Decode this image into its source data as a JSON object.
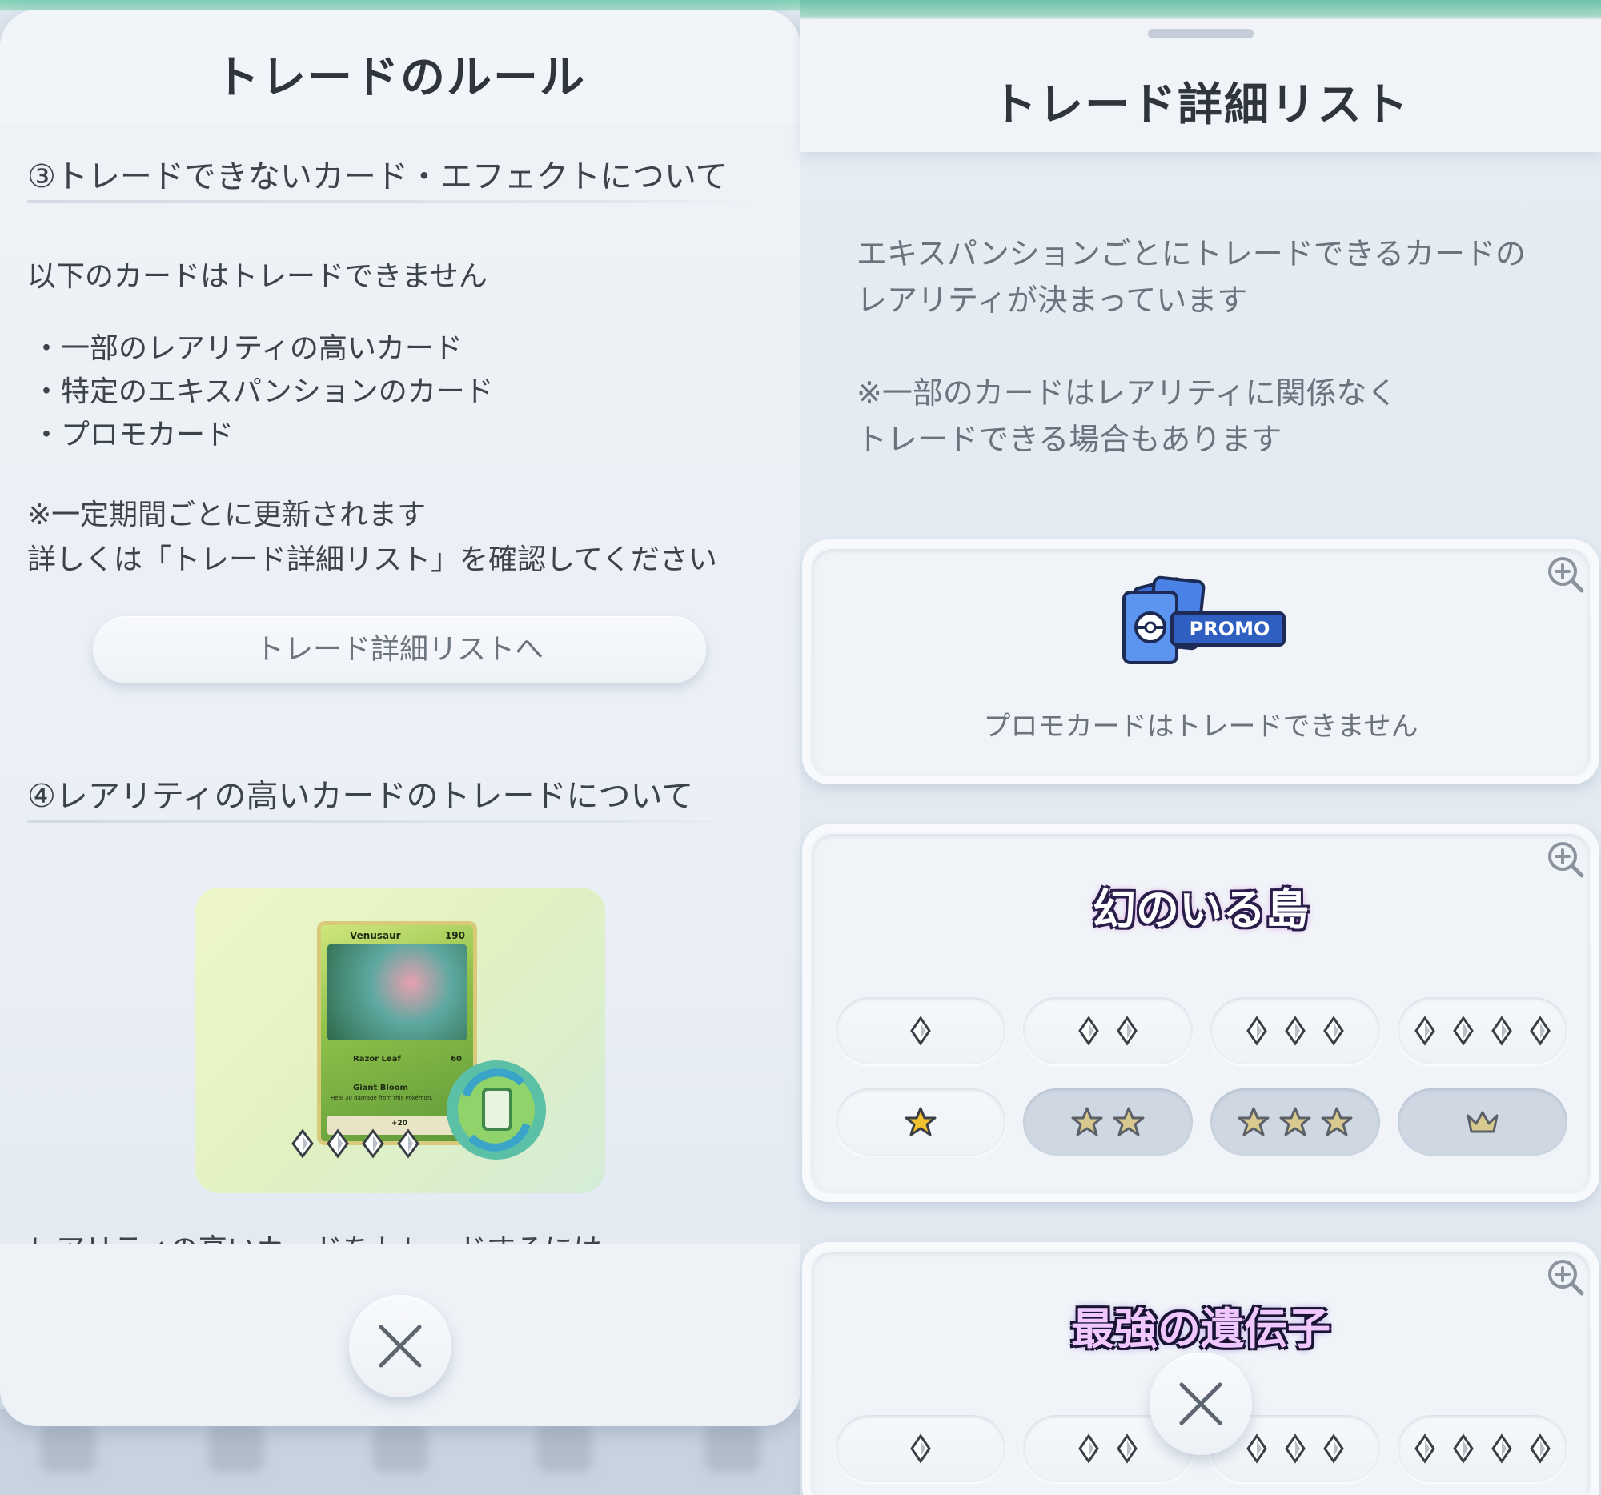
{
  "left": {
    "title": "トレードのルール",
    "section3_title": "③トレードできないカード・エフェクトについて",
    "intro": "以下のカードはトレードできません",
    "bullets": [
      "・一部のレアリティの高いカード",
      "・特定のエキスパンションのカード",
      "・プロモカード"
    ],
    "note_line1": "※一定期間ごとに更新されます",
    "note_line2": "詳しくは「トレード詳細リスト」を確認してください",
    "list_button": "トレード詳細リストへ",
    "section4_title": "④レアリティの高いカードのトレードについて",
    "card": {
      "name": "Venusaur",
      "hp": "190",
      "move1": "Razor Leaf",
      "move1_damage": "60",
      "move2": "Giant Bloom",
      "move2_desc": "Heal 30 damage from this Pokémon.",
      "bottom_damage": "+20"
    },
    "cut_text": "レアリティの高いカードをトレードするには"
  },
  "right": {
    "title": "トレード詳細リスト",
    "desc_line1": "エキスパンションごとにトレードできるカードの",
    "desc_line2": "レアリティが決まっています",
    "note_line1": "※一部のカードはレアリティに関係なく",
    "note_line2": "トレードできる場合もあります",
    "promo": {
      "badge": "PROMO",
      "caption": "プロモカードはトレードできません"
    },
    "expansion1": {
      "logo": "幻のいる島",
      "rarities": [
        "1-diamond",
        "2-diamond",
        "3-diamond",
        "4-diamond",
        "1-star",
        "2-star",
        "3-star",
        "crown"
      ],
      "tradeable": [
        true,
        true,
        true,
        true,
        true,
        false,
        false,
        false
      ]
    },
    "expansion2": {
      "logo": "最強の遺伝子",
      "rarities": [
        "1-diamond",
        "2-diamond",
        "3-diamond",
        "4-diamond"
      ]
    }
  },
  "colors": {
    "text_dark": "#2f353c",
    "text_gray": "#6b737d",
    "panel": "#eef2f7",
    "pill_disabled": "#cfd7e3",
    "star_gold": "#f2c12e"
  },
  "icons": [
    "close-icon",
    "zoom-in-icon",
    "diamond-icon",
    "star-icon",
    "crown-icon",
    "trade-icon",
    "card-pack-icon"
  ]
}
